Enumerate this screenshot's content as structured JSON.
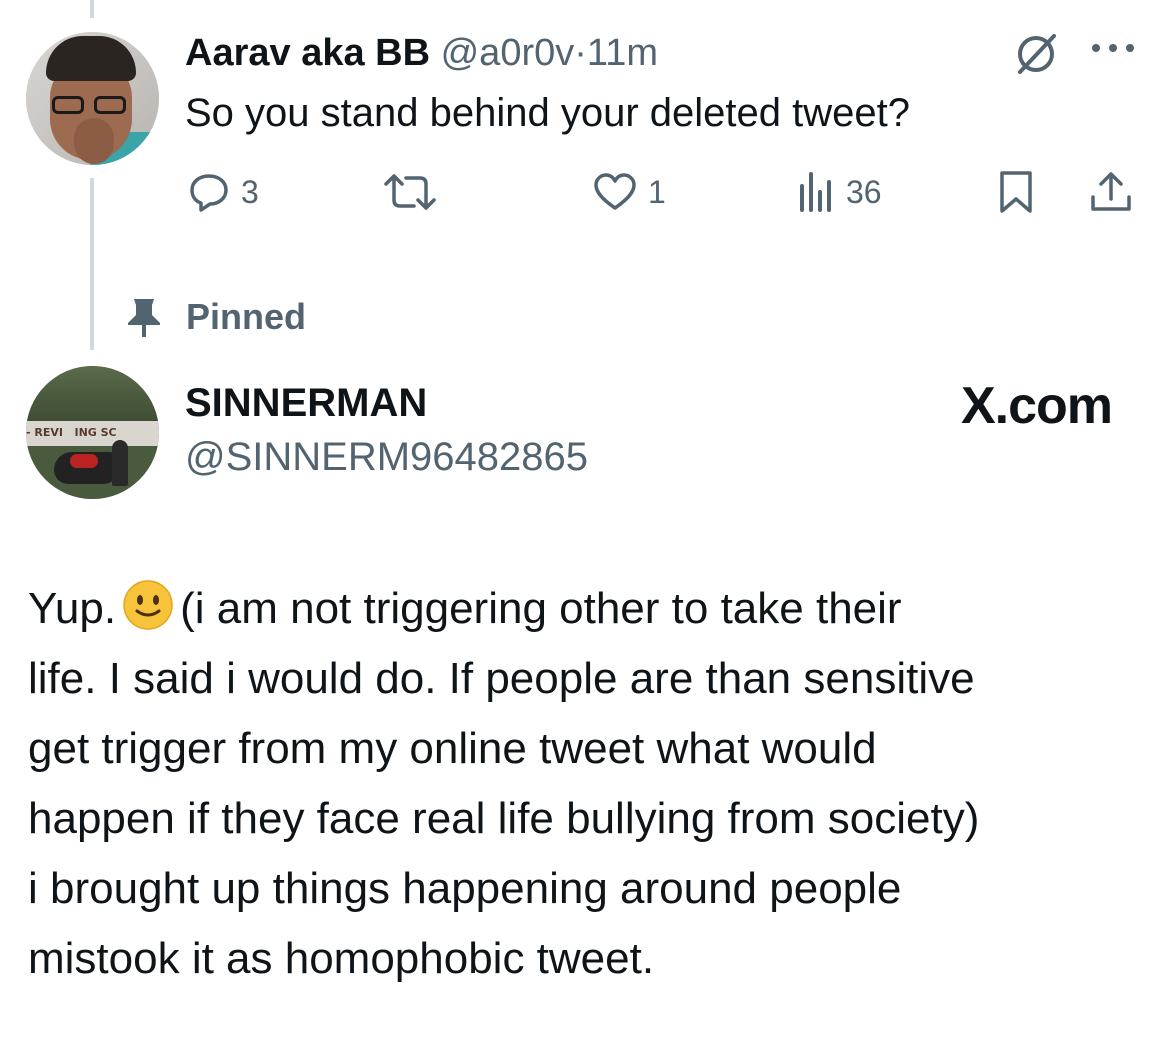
{
  "reply": {
    "display_name": "Aarav aka BB",
    "handle": "@a0r0v",
    "dot": "·",
    "time": "11m",
    "text": "So you stand behind your deleted tweet?",
    "counts": {
      "replies": "3",
      "likes": "1",
      "views": "36"
    },
    "icons": [
      "grok-icon",
      "more-icon",
      "reply-icon",
      "repost-icon",
      "like-icon",
      "views-icon",
      "bookmark-icon",
      "share-icon"
    ]
  },
  "pinned": {
    "label": "Pinned",
    "icon": "pin-icon"
  },
  "main_tweet": {
    "display_name": "SINNERMAN",
    "handle": "@SINNERM96482865",
    "watermark": "X.com",
    "avatar_sign_text": "- REVI   ING SC",
    "text_first": "Yup.",
    "emoji": "slightly-smiling-face",
    "text_lines": [
      "(i am not triggering other to take their",
      "life. I said i would do. If people are than sensitive",
      "get trigger from my online tweet what would",
      "happen if they face real life bullying from society)",
      "i brought up things happening around people",
      "mistook it as homophobic tweet."
    ]
  },
  "colors": {
    "text": "#0f1419",
    "secondary": "#536471",
    "thread_line": "#cfd9de",
    "emoji": "#f7c33a"
  }
}
